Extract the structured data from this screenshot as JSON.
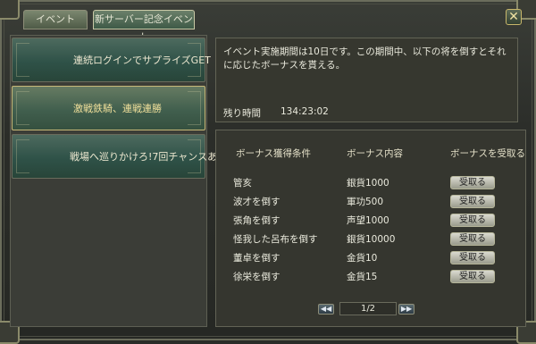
{
  "tabs": [
    {
      "label": "イベント"
    },
    {
      "label": "新サーバー記念イベント"
    }
  ],
  "close_label": "✕",
  "events": [
    {
      "label": "連続ログインでサプライズGET"
    },
    {
      "label": "激戦鉄騎、連戦連勝"
    },
    {
      "label": "戦場へ巡りかけろ!7回チャンスあ"
    }
  ],
  "description": {
    "text": "イベント実施期間は10日です。この期間中、以下の将を倒すとそれに応じたボーナスを貰える。",
    "remaining_label": "残り時間",
    "remaining_value": "134:23:02"
  },
  "bonus_table": {
    "headers": [
      "ボーナス獲得条件",
      "ボーナス内容",
      "ボーナスを受取る方"
    ],
    "rows": [
      {
        "condition": "管亥",
        "reward": "銀貨1000",
        "button": "受取る"
      },
      {
        "condition": "波才を倒す",
        "reward": "軍功500",
        "button": "受取る"
      },
      {
        "condition": "張角を倒す",
        "reward": "声望1000",
        "button": "受取る"
      },
      {
        "condition": "怪我した呂布を倒す",
        "reward": "銀貨10000",
        "button": "受取る"
      },
      {
        "condition": "董卓を倒す",
        "reward": "金貨10",
        "button": "受取る"
      },
      {
        "condition": "徐栄を倒す",
        "reward": "金貨15",
        "button": "受取る"
      }
    ]
  },
  "pager": {
    "prev_label": "◀◀",
    "page": "1/2",
    "next_label": "▶▶"
  }
}
